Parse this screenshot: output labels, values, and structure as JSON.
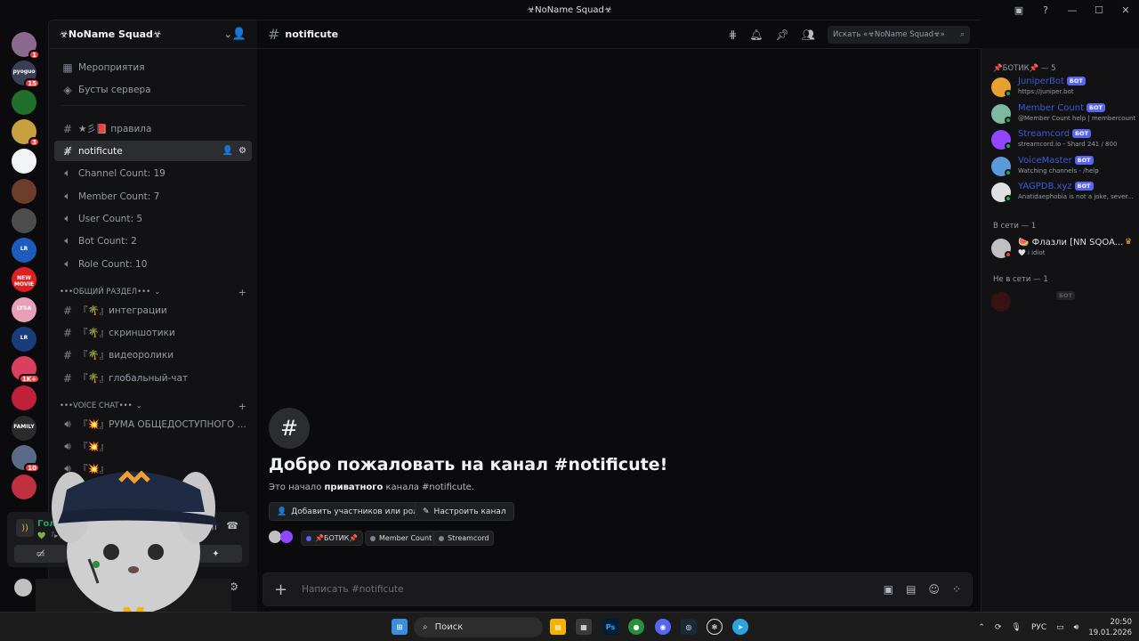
{
  "window": {
    "title": "☣NoName Squad☣",
    "controls": [
      "inbox-icon",
      "help-icon",
      "minimize-icon",
      "maximize-icon",
      "close-icon"
    ]
  },
  "servers": [
    {
      "badge": "1",
      "color": "#8a6b8f"
    },
    {
      "badge": "15",
      "color": "#3a3f55",
      "label": "pyoguo"
    },
    {
      "badge": "",
      "color": "#1f6f2b"
    },
    {
      "badge": "3",
      "color": "#c8a040"
    },
    {
      "badge": "",
      "color": "#f2f3f5"
    },
    {
      "badge": "",
      "color": "#6b3d2a"
    },
    {
      "badge": "",
      "color": "#4d4d4d"
    },
    {
      "badge": "",
      "color": "#1e5bbf",
      "label": "LR"
    },
    {
      "badge": "",
      "color": "#e02020",
      "label": "NEW MOVIE"
    },
    {
      "badge": "",
      "color": "#e8a0b8",
      "label": "LYSA"
    },
    {
      "badge": "",
      "color": "#1a3c7a",
      "label": "LR"
    },
    {
      "badge": "1K+",
      "color": "#d94060"
    },
    {
      "badge": "",
      "color": "#c0203a"
    },
    {
      "badge": "",
      "color": "#2b2b2b",
      "label": "FAMILY"
    },
    {
      "badge": "10",
      "color": "#5a6b8a"
    },
    {
      "badge": "",
      "color": "#c03040"
    }
  ],
  "guild": {
    "name": "☣NoName Squad☣",
    "top_items": [
      {
        "icon": "calendar-icon",
        "label": "Мероприятия"
      },
      {
        "icon": "boost-icon",
        "label": "Бусты сервера"
      }
    ],
    "channels": [
      {
        "icon": "hash",
        "label": "★彡📕 правила"
      },
      {
        "icon": "hash-lock",
        "label": "notificute",
        "active": true
      },
      {
        "icon": "speaker",
        "label": "Channel Count: 19"
      },
      {
        "icon": "speaker",
        "label": "Member Count: 7"
      },
      {
        "icon": "speaker",
        "label": "User Count: 5"
      },
      {
        "icon": "speaker",
        "label": "Bot Count: 2"
      },
      {
        "icon": "speaker",
        "label": "Role Count: 10"
      }
    ],
    "category1": "•••ОБЩИЙ РАЗДЕЛ•••",
    "cat1_channels": [
      "『🌴』интеграции",
      "『🌴』скриншотики",
      "『🌴』видеоролики",
      "『🌴』глобальный-чат"
    ],
    "category2": "•••VOICE CHAT•••",
    "voice_channels": [
      "『💥』РУМА ОБЩЕДОСТУПНОГО ...",
      "『💥』",
      "『💥』",
      "『💥』"
    ]
  },
  "voice_status": {
    "connected": "Голосова",
    "sub": "💚 『▸ Дно"
  },
  "channel": {
    "name": "notificute",
    "search_placeholder": "Искать «☣NoName Squad☣»"
  },
  "welcome": {
    "title": "Добро пожаловать на канал #notificute!",
    "sub_prefix": "Это начало ",
    "sub_bold": "приватного",
    "sub_suffix": " канала #notificute.",
    "btn_add": "Добавить участников или роли",
    "btn_settings": "Настроить канал",
    "chips": [
      "📌БОТИК📌",
      "Member Count",
      "Streamcord"
    ]
  },
  "composer": {
    "placeholder": "Написать #notificute"
  },
  "members": {
    "group_bots": "📌БОТИК📌 — 5",
    "bots": [
      {
        "name": "JuniperBot",
        "activity": "https://juniper.bot",
        "color": "#e8a030"
      },
      {
        "name": "Member Count",
        "activity": "@Member Count help | membercount",
        "color": "#7fb8a0"
      },
      {
        "name": "Streamcord",
        "activity": "streamcord.io - Shard 241 / 800",
        "color": "#9146ff"
      },
      {
        "name": "VoiceMaster",
        "activity": "Watching channels - /help",
        "color": "#5a9ad8"
      },
      {
        "name": "YAGPDB.xyz",
        "activity": "Anatidaephobia is not a joke, sever...",
        "color": "#e0e0e0"
      }
    ],
    "bot_tag": "БОТ",
    "group_online": "В сети — 1",
    "online": [
      {
        "name": "🍉 Флазли [NN SQOA...",
        "activity": "🤍 i idiot",
        "color": "#c0c0c0"
      }
    ],
    "group_offline": "Не в сети — 1",
    "offline_tag": "БОТ"
  },
  "taskbar": {
    "search": "Поиск",
    "lang": "РУС",
    "time": "20:50",
    "date": "19.01.2026",
    "apps": [
      "windows-icon",
      "search",
      "files-icon",
      "store-icon",
      "photoshop-icon",
      "chrome-icon",
      "discord-icon",
      "steam-icon",
      "chatgpt-icon",
      "telegram-icon"
    ]
  }
}
